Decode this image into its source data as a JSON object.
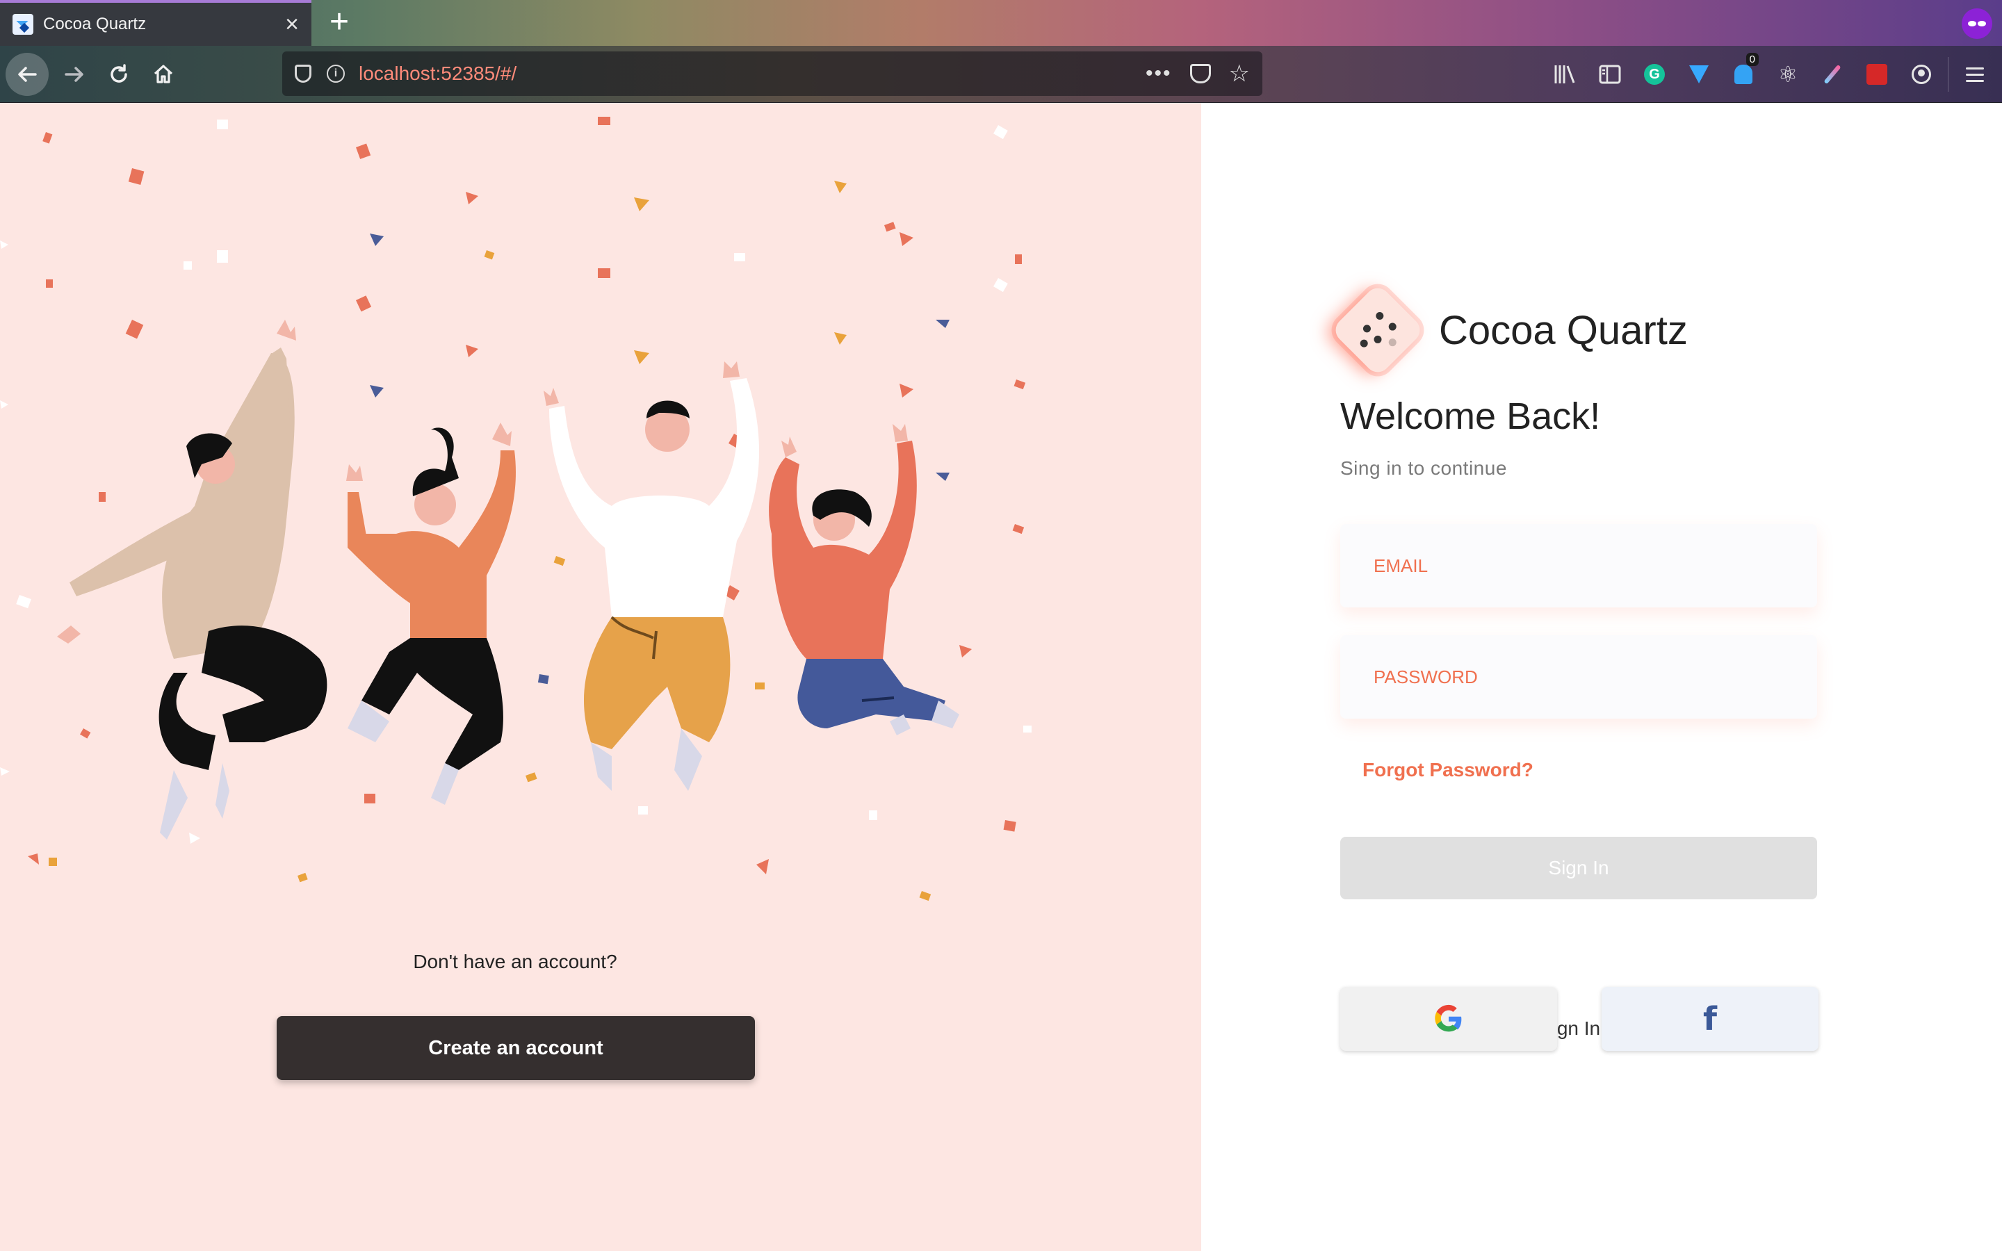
{
  "browser": {
    "tab_title": "Cocoa Quartz",
    "tab_close_icon": "×",
    "new_tab_icon": "+",
    "url": "localhost:52385/#/",
    "url_more": "•••",
    "notification_count": "0"
  },
  "left": {
    "signup_prompt": "Don't have an account?",
    "create_account_label": "Create an account"
  },
  "form": {
    "brand_name": "Cocoa Quartz",
    "welcome_title": "Welcome Back!",
    "subtitle": "Sing in to continue",
    "email_placeholder": "EMAIL",
    "password_placeholder": "PASSWORD",
    "forgot_password": "Forgot Password?",
    "signin_label": "Sign In",
    "divider_text": "Or Sign In With",
    "facebook_glyph": "f"
  },
  "colors": {
    "accent": "#f0704f",
    "left_bg": "#fde6e2",
    "dark_button": "#352f2f",
    "signin_disabled": "#e0e0e0",
    "facebook_blue": "#3b5998"
  },
  "icons": [
    "back-arrow-icon",
    "forward-arrow-icon",
    "reload-icon",
    "home-icon",
    "shield-icon",
    "info-icon",
    "pocket-icon",
    "star-icon",
    "library-icon",
    "sidebar-icon",
    "grammarly-icon",
    "gem-icon",
    "bell-icon",
    "react-icon",
    "color-picker-icon",
    "red-extension-icon",
    "account-icon",
    "hamburger-menu-icon",
    "private-browsing-icon",
    "google-icon",
    "facebook-icon"
  ]
}
